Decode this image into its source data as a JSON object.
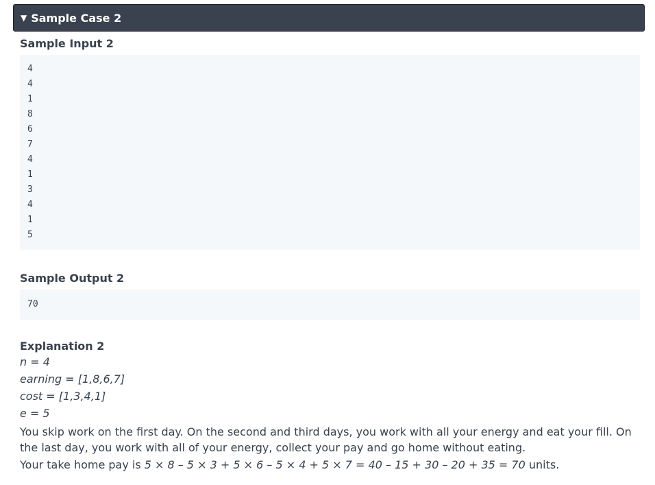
{
  "header": {
    "triangle_glyph": "▼",
    "title": "Sample Case 2"
  },
  "sample_input": {
    "title": "Sample Input 2",
    "lines": [
      "4",
      "4",
      "1",
      "8",
      "6",
      "7",
      "4",
      "1",
      "3",
      "4",
      "1",
      "5"
    ]
  },
  "sample_output": {
    "title": "Sample Output 2",
    "lines": [
      "70"
    ]
  },
  "explanation": {
    "title": "Explanation 2",
    "vars": [
      "n = 4",
      "earning = [1,8,6,7]",
      "cost = [1,3,4,1]",
      "e = 5"
    ],
    "paragraph": "You skip work on the first day. On the second and third days, you work with all your energy and eat your fill. On the last day, you work with all of your energy, collect your pay and go home without eating.",
    "pay_prefix": "Your take home pay is",
    "pay_formula": "5 × 8 – 5 × 3 + 5 × 6 – 5 × 4 + 5 × 7 = 40 – 15 + 30 – 20 + 35 = 70",
    "pay_suffix": "units."
  },
  "colors": {
    "header_bg": "#39424e",
    "code_bg": "#f4f8fb",
    "text": "#39424e"
  }
}
